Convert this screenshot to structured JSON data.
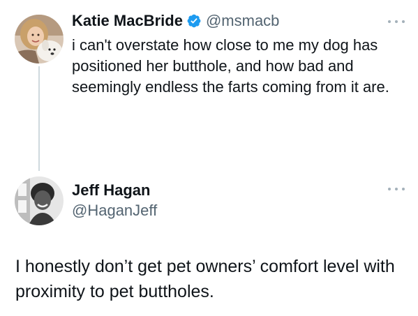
{
  "tweet1": {
    "display_name": "Katie MacBride",
    "handle": "@msmacb",
    "text": "i can't overstate how close to me my dog has positioned her butthole, and how bad and seemingly endless the farts coming from it are.",
    "avatar_icon": "profile-photo-woman-with-dog",
    "verified_icon": "verified-badge-icon",
    "verified_color": "#1d9bf0"
  },
  "tweet2": {
    "display_name": "Jeff Hagan",
    "handle": "@HaganJeff",
    "text": "I honestly don’t get pet owners’ comfort level with proximity to pet buttholes.",
    "avatar_icon": "profile-photo-man-black-and-white"
  },
  "colors": {
    "text_primary": "#0f1419",
    "text_secondary": "#536471",
    "thread_line": "#cfd9de",
    "more_dots": "#a4b1ba"
  }
}
